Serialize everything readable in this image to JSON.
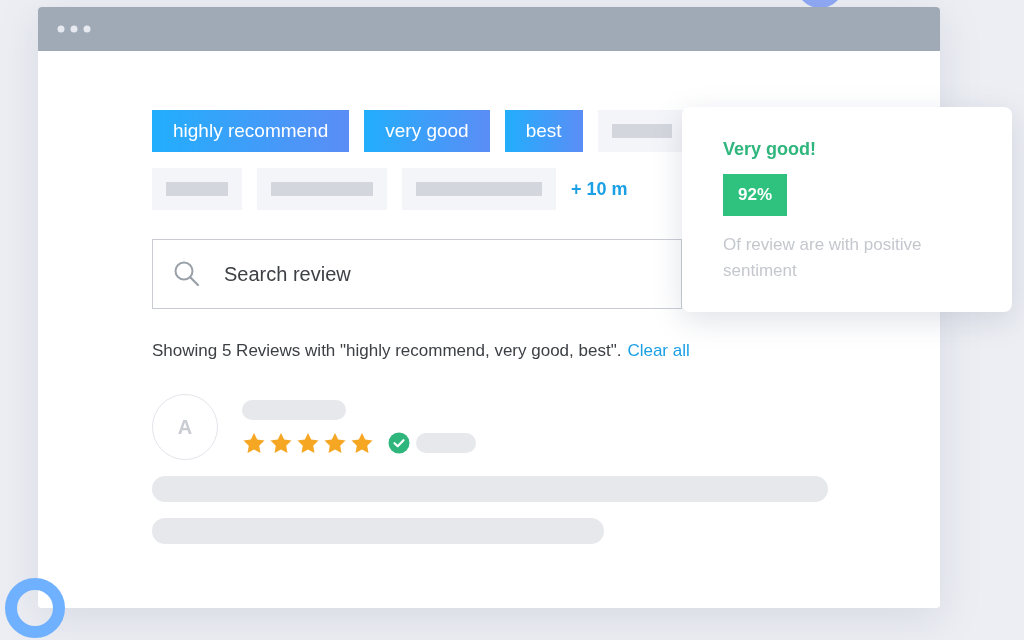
{
  "tags": [
    {
      "label": "highly recommend",
      "selected": true
    },
    {
      "label": "very good",
      "selected": true
    },
    {
      "label": "best",
      "selected": true
    }
  ],
  "more_link": "+ 10 m",
  "search": {
    "placeholder": "Search review"
  },
  "summary": {
    "text": "Showing 5 Reviews with \"highly recommend, very good, best\".",
    "link": "Clear all"
  },
  "review": {
    "avatar": "A",
    "stars": 5,
    "verified": true
  },
  "popup": {
    "title": "Very good!",
    "badge": "92%",
    "caption": "Of review are with positive sentiment"
  }
}
